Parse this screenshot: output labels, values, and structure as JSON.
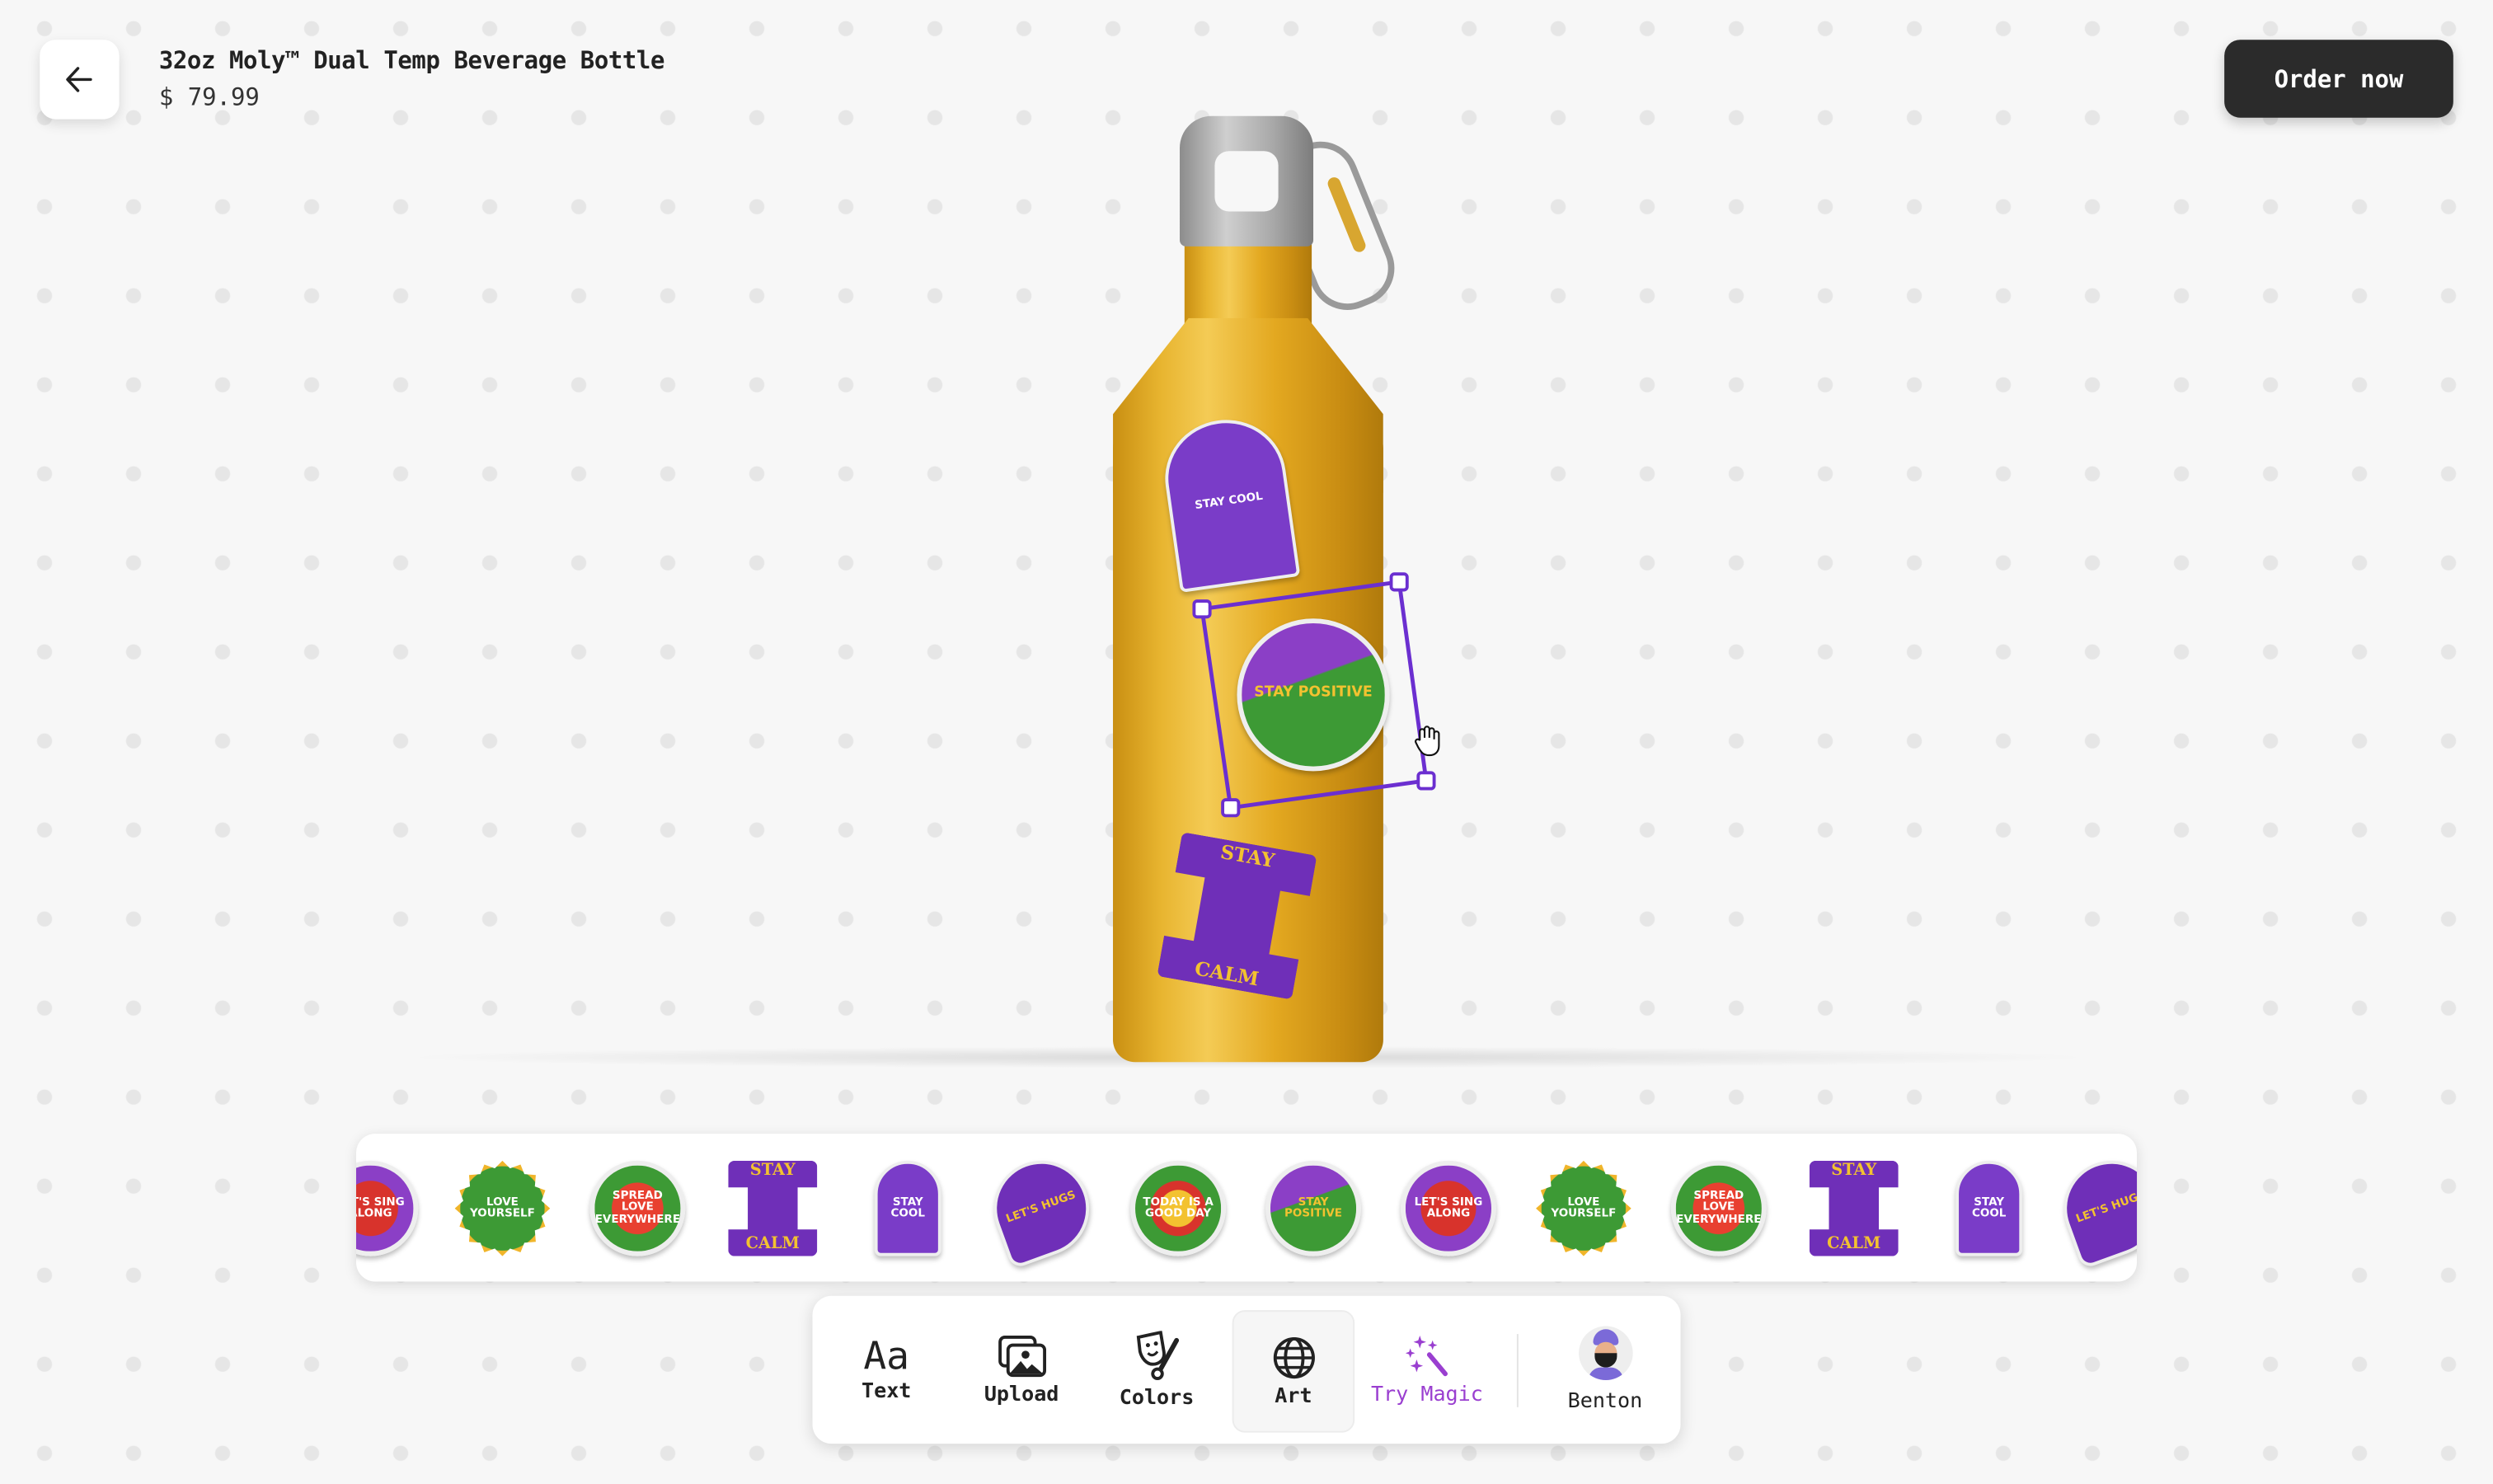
{
  "header": {
    "back_icon": "arrow-left-icon",
    "product_title": "32oz Moly™ Dual Temp Beverage Bottle",
    "price": "$ 79.99",
    "order_label": "Order now"
  },
  "colors": {
    "accent_purple": "#6b2fd0",
    "magic_purple": "#9a3fd0",
    "bottle_yellow": "#e3a820",
    "order_button": "#2b2b2b"
  },
  "canvas": {
    "applied_stickers": [
      {
        "text": "STAY COOL",
        "selected": false
      },
      {
        "text": "STAY POSITIVE",
        "selected": true
      },
      {
        "text": "STAY CALM",
        "selected": false
      }
    ],
    "cursor_icon": "grab-hand-icon"
  },
  "sticker_strip": {
    "items": [
      {
        "text": "LET'S SING ALONG",
        "style": "purple"
      },
      {
        "text": "LOVE YOURSELF",
        "style": "sun"
      },
      {
        "text": "SPREAD LOVE EVERYWHERE",
        "style": "green"
      },
      {
        "text": "STAY CALM",
        "style": "calm"
      },
      {
        "text": "STAY COOL",
        "style": "cool"
      },
      {
        "text": "LET'S HUGS",
        "style": "hugs"
      },
      {
        "text": "TODAY IS A GOOD DAY",
        "style": "today"
      },
      {
        "text": "STAY POSITIVE",
        "style": "positive"
      },
      {
        "text": "LET'S SING ALONG",
        "style": "purple"
      },
      {
        "text": "LOVE YOURSELF",
        "style": "sun"
      },
      {
        "text": "SPREAD LOVE EVERYWHERE",
        "style": "green"
      },
      {
        "text": "STAY CALM",
        "style": "calm"
      },
      {
        "text": "STAY COOL",
        "style": "cool"
      },
      {
        "text": "LET'S HUGS",
        "style": "hugs"
      }
    ]
  },
  "toolbar": {
    "items": [
      {
        "label": "Text",
        "icon": "text-aa-icon"
      },
      {
        "label": "Upload",
        "icon": "image-upload-icon"
      },
      {
        "label": "Colors",
        "icon": "mask-brush-icon"
      },
      {
        "label": "Art",
        "icon": "globe-icon",
        "active": true
      },
      {
        "label": "Try Magic",
        "icon": "magic-wand-sparkles-icon"
      },
      {
        "label": "Benton",
        "icon": "avatar"
      }
    ],
    "aa_glyph": "Aa"
  }
}
